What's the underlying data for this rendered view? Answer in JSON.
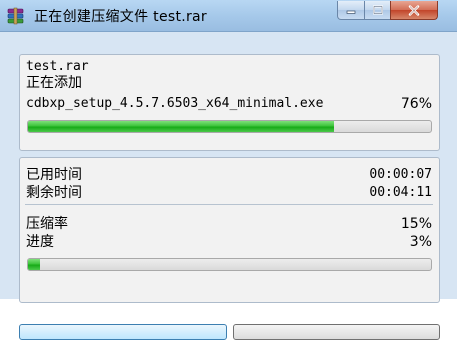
{
  "window": {
    "title": "正在创建压缩文件 test.rar"
  },
  "archive": {
    "name": "test.rar",
    "status": "正在添加",
    "current_file": "cdbxp_setup_4.5.7.6503_x64_minimal.exe",
    "current_file_percent": "76%",
    "current_file_progress": 0.76
  },
  "timing": {
    "elapsed_label": "已用时间",
    "elapsed_value": "00:00:07",
    "remaining_label": "剩余时间",
    "remaining_value": "00:04:11"
  },
  "stats": {
    "ratio_label": "压缩率",
    "ratio_value": "15%",
    "progress_label": "进度",
    "progress_value": "3%",
    "overall_progress": 0.03
  },
  "colors": {
    "title_bar": "#a6c9ea",
    "client_bg": "#d7e5f3",
    "progress_fill": "#3cc43a",
    "close_button": "#c2452a"
  },
  "icons": {
    "app": "winrar-books-icon",
    "minimize": "minimize-icon",
    "maximize": "maximize-icon",
    "close": "close-icon"
  }
}
